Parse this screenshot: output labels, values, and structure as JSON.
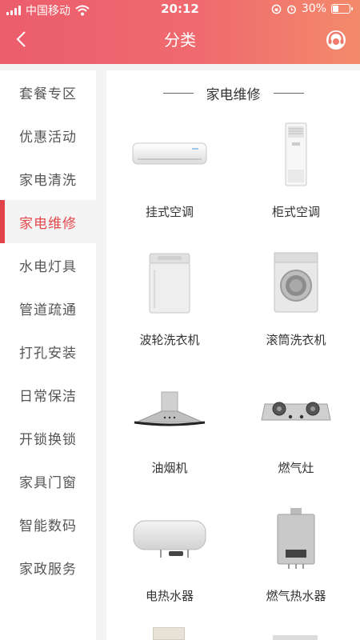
{
  "status_bar": {
    "carrier": "中国移动",
    "time": "20:12",
    "battery": "30%",
    "battery_level": 0.3
  },
  "nav": {
    "title": "分类",
    "back_icon": "chevron-left-icon",
    "service_icon": "customer-service-icon"
  },
  "sidebar": {
    "active_index": 3,
    "items": [
      {
        "label": "套餐专区"
      },
      {
        "label": "优惠活动"
      },
      {
        "label": "家电清洗"
      },
      {
        "label": "家电维修"
      },
      {
        "label": "水电灯具"
      },
      {
        "label": "管道疏通"
      },
      {
        "label": "打孔安装"
      },
      {
        "label": "日常保洁"
      },
      {
        "label": "开锁换锁"
      },
      {
        "label": "家具门窗"
      },
      {
        "label": "智能数码"
      },
      {
        "label": "家政服务"
      }
    ]
  },
  "section": {
    "title": "家电维修",
    "items": [
      {
        "label": "挂式空调",
        "icon": "wall-air-conditioner-icon"
      },
      {
        "label": "柜式空调",
        "icon": "standing-air-conditioner-icon"
      },
      {
        "label": "波轮洗衣机",
        "icon": "top-load-washer-icon"
      },
      {
        "label": "滚筒洗衣机",
        "icon": "front-load-washer-icon"
      },
      {
        "label": "油烟机",
        "icon": "range-hood-icon"
      },
      {
        "label": "燃气灶",
        "icon": "gas-stove-icon"
      },
      {
        "label": "电热水器",
        "icon": "electric-water-heater-icon"
      },
      {
        "label": "燃气热水器",
        "icon": "gas-water-heater-icon"
      }
    ]
  },
  "colors": {
    "header_start": "#ec5d6c",
    "header_end": "#f38a6b",
    "accent": "#e2434a"
  }
}
